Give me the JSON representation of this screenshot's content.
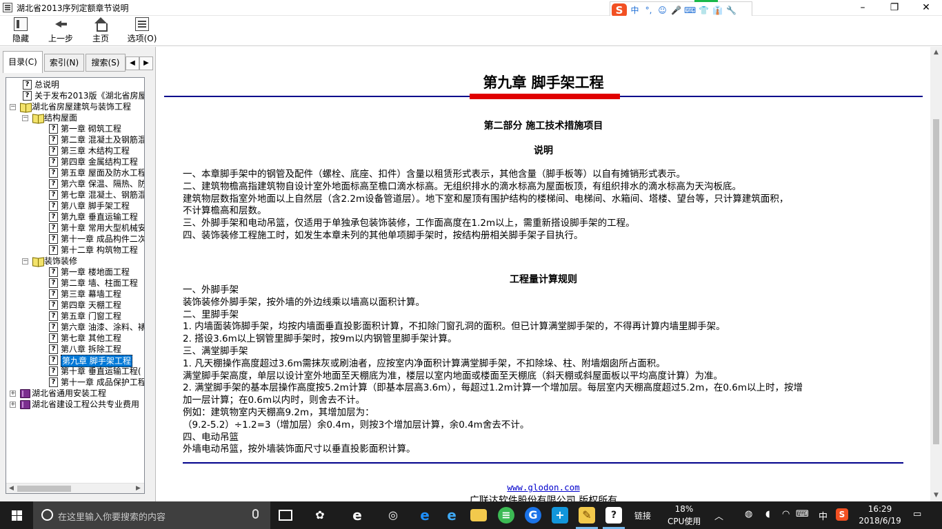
{
  "window": {
    "title": "湖北省2013序列定额章节说明",
    "min": "–",
    "max": "❐",
    "close": "✕"
  },
  "ime": {
    "logo": "S",
    "items": [
      "中",
      "°,",
      "☺",
      "🎤",
      "⌨",
      "👕",
      "👔",
      "🔧"
    ]
  },
  "toolbar": {
    "hide": "隐藏",
    "back": "上一步",
    "home": "主页",
    "options": "选项(O)"
  },
  "tabs": {
    "contents": "目录(C)",
    "index": "索引(N)",
    "search": "搜索(S)",
    "left": "◀",
    "right": "▶"
  },
  "tree": [
    {
      "label": "总说明",
      "type": "page",
      "level": 1
    },
    {
      "label": "关于发布2013版《湖北省房屋",
      "type": "page",
      "level": 1
    },
    {
      "label": "湖北省房屋建筑与装饰工程",
      "type": "book-open",
      "level": 0,
      "expander": "−"
    },
    {
      "label": "结构屋面",
      "type": "book-open",
      "level": 1,
      "expander": "−"
    },
    {
      "label": "第一章 砌筑工程",
      "type": "page",
      "level": 3
    },
    {
      "label": "第二章 混凝土及钢筋混",
      "type": "page",
      "level": 3
    },
    {
      "label": "第三章 木结构工程",
      "type": "page",
      "level": 3
    },
    {
      "label": "第四章 金属结构工程",
      "type": "page",
      "level": 3
    },
    {
      "label": "第五章 屋面及防水工程",
      "type": "page",
      "level": 3
    },
    {
      "label": "第六章 保温、隔热、防",
      "type": "page",
      "level": 3
    },
    {
      "label": "第七章 混凝土、钢筋混",
      "type": "page",
      "level": 3
    },
    {
      "label": "第八章 脚手架工程",
      "type": "page",
      "level": 3
    },
    {
      "label": "第九章 垂直运输工程",
      "type": "page",
      "level": 3
    },
    {
      "label": "第十章 常用大型机械安",
      "type": "page",
      "level": 3
    },
    {
      "label": "第十一章 成品构件二次",
      "type": "page",
      "level": 3
    },
    {
      "label": "第十二章 构筑物工程",
      "type": "page",
      "level": 3
    },
    {
      "label": "装饰装修",
      "type": "book-open",
      "level": 1,
      "expander": "−"
    },
    {
      "label": "第一章 楼地面工程",
      "type": "page",
      "level": 3
    },
    {
      "label": "第二章 墙、柱面工程",
      "type": "page",
      "level": 3
    },
    {
      "label": "第三章 幕墙工程",
      "type": "page",
      "level": 3
    },
    {
      "label": "第四章 天棚工程",
      "type": "page",
      "level": 3
    },
    {
      "label": "第五章 门窗工程",
      "type": "page",
      "level": 3
    },
    {
      "label": "第六章 油漆、涂料、裱",
      "type": "page",
      "level": 3
    },
    {
      "label": "第七章 其他工程",
      "type": "page",
      "level": 3
    },
    {
      "label": "第八章 拆除工程",
      "type": "page",
      "level": 3
    },
    {
      "label": "第九章 脚手架工程",
      "type": "page",
      "level": 3,
      "selected": true
    },
    {
      "label": "第十章 垂直运输工程(",
      "type": "page",
      "level": 3
    },
    {
      "label": "第十一章 成品保护工程",
      "type": "page",
      "level": 3
    },
    {
      "label": "湖北省通用安装工程",
      "type": "book-closed",
      "level": 0,
      "expander": "+"
    },
    {
      "label": "湖北省建设工程公共专业费用",
      "type": "book-closed",
      "level": 0,
      "expander": "+"
    }
  ],
  "scroll": {
    "left": "◀",
    "right": "▶",
    "up": "▲",
    "down": "▼"
  },
  "doc": {
    "title": "第九章 脚手架工程",
    "part": "第二部分 施工技术措施项目",
    "explain": "说明",
    "explain_lines": [
      "一、本章脚手架中的钢管及配件（螺栓、底座、扣件）含量以租赁形式表示，其他含量（脚手板等）以自有摊销形式表示。",
      "二、建筑物檐高指建筑物自设计室外地面标高至檐口滴水标高。无组织排水的滴水标高为屋面板顶，有组织排水的滴水标高为天沟板底。",
      "建筑物层数指室外地面以上自然层（含2.2m设备管道层）。地下室和屋顶有围护结构的楼梯间、电梯间、水箱间、塔楼、望台等，只计算建筑面积，",
      "不计算檐高和层数。",
      "三、外脚手架和电动吊篮，仅适用于单独承包装饰装修，工作面高度在1.2m以上，需重新搭设脚手架的工程。",
      "四、装饰装修工程施工时，如发生本章未列的其他单项脚手架时，按结构册相关脚手架子目执行。"
    ],
    "rules_heading": "工程量计算规则",
    "rules_lines": [
      "一、外脚手架",
      "装饰装修外脚手架，按外墙的外边线乘以墙高以面积计算。",
      "二、里脚手架",
      "1. 内墙面装饰脚手架，均按内墙面垂直投影面积计算，不扣除门窗孔洞的面积。但已计算满堂脚手架的，不得再计算内墙里脚手架。",
      "2. 搭设3.6m以上钢管里脚手架时，按9m以内钢管里脚手架计算。",
      "三、满堂脚手架",
      "1. 凡天棚操作高度超过3.6m需抹灰或刷油者，应按室内净面积计算满堂脚手架，不扣除垛、柱、附墙烟囱所占面积。",
      "满堂脚手架高度，单层以设计室外地面至天棚底为准，楼层以室内地面或楼面至天棚底（斜天棚或斜屋面板以平均高度计算）为准。",
      "2. 满堂脚手架的基本层操作高度按5.2m计算（即基本层高3.6m），每超过1.2m计算一个增加层。每层室内天棚高度超过5.2m，在0.6m以上时，按增",
      "加一层计算；在0.6m以内时，则舍去不计。",
      "例如：建筑物室内天棚高9.2m，其增加层为：",
      "（9.2-5.2）÷1.2=3（增加层）余0.4m，则按3个增加层计算，余0.4m舍去不计。",
      "四、电动吊篮",
      "外墙电动吊篮，按外墙装饰面尺寸以垂直投影面积计算。"
    ],
    "link": "www.glodon.com",
    "copyright": "广联达软件股份有限公司 版权所有"
  },
  "taskbar": {
    "search_placeholder": "在这里输入你要搜索的内容",
    "links": "链接",
    "cpu_percent": "18%",
    "cpu_label": "CPU使用",
    "ime_lang": "中",
    "time": "16:29",
    "date": "2018/6/19"
  }
}
